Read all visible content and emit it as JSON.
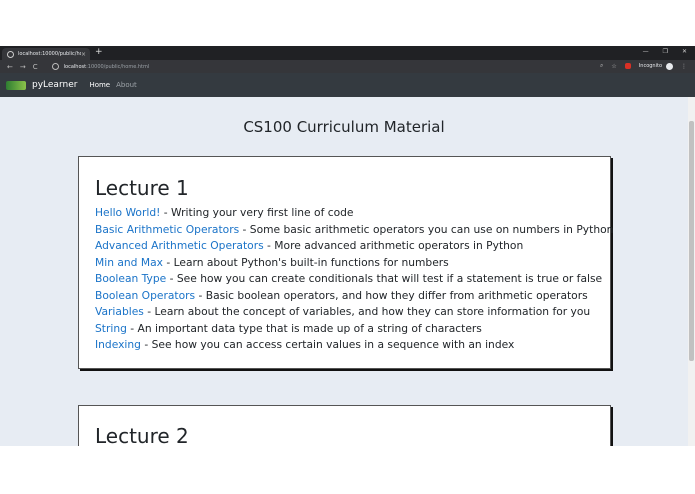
{
  "browser": {
    "tab_title": "localhost:10000/public/home.ht",
    "tab_close": "×",
    "new_tab": "+",
    "window_controls": [
      "—",
      "❐",
      "✕"
    ],
    "nav_buttons": [
      "←",
      "→",
      "C"
    ],
    "url_host": "localhost",
    "url_rest": ":10000/public/home.html",
    "incognito_label": "Incognito"
  },
  "site": {
    "brand": "pyLearner",
    "nav": [
      {
        "label": "Home",
        "active": true
      },
      {
        "label": "About",
        "active": false
      }
    ]
  },
  "page": {
    "title": "CS100 Curriculum Material",
    "lectures": [
      {
        "title": "Lecture 1",
        "lessons": [
          {
            "link": "Hello World!",
            "desc": " - Writing your very first line of code"
          },
          {
            "link": "Basic Arithmetic Operators",
            "desc": " - Some basic arithmetic operators you can use on numbers in Python"
          },
          {
            "link": "Advanced Arithmetic Operators",
            "desc": " - More advanced arithmetic operators in Python"
          },
          {
            "link": "Min and Max",
            "desc": " - Learn about Python's built-in functions for numbers"
          },
          {
            "link": "Boolean Type",
            "desc": " - See how you can create conditionals that will test if a statement is true or false"
          },
          {
            "link": "Boolean Operators",
            "desc": " - Basic boolean operators, and how they differ from arithmetic operators"
          },
          {
            "link": "Variables",
            "desc": " - Learn about the concept of variables, and how they can store information for you"
          },
          {
            "link": "String",
            "desc": " - An important data type that is made up of a string of characters"
          },
          {
            "link": "Indexing",
            "desc": " - See how you can access certain values in a sequence with an index"
          }
        ]
      },
      {
        "title": "Lecture 2",
        "lessons": []
      }
    ]
  },
  "colors": {
    "link": "#1a73c8",
    "navbar": "#343a40",
    "page_bg": "#e7ecf3"
  }
}
